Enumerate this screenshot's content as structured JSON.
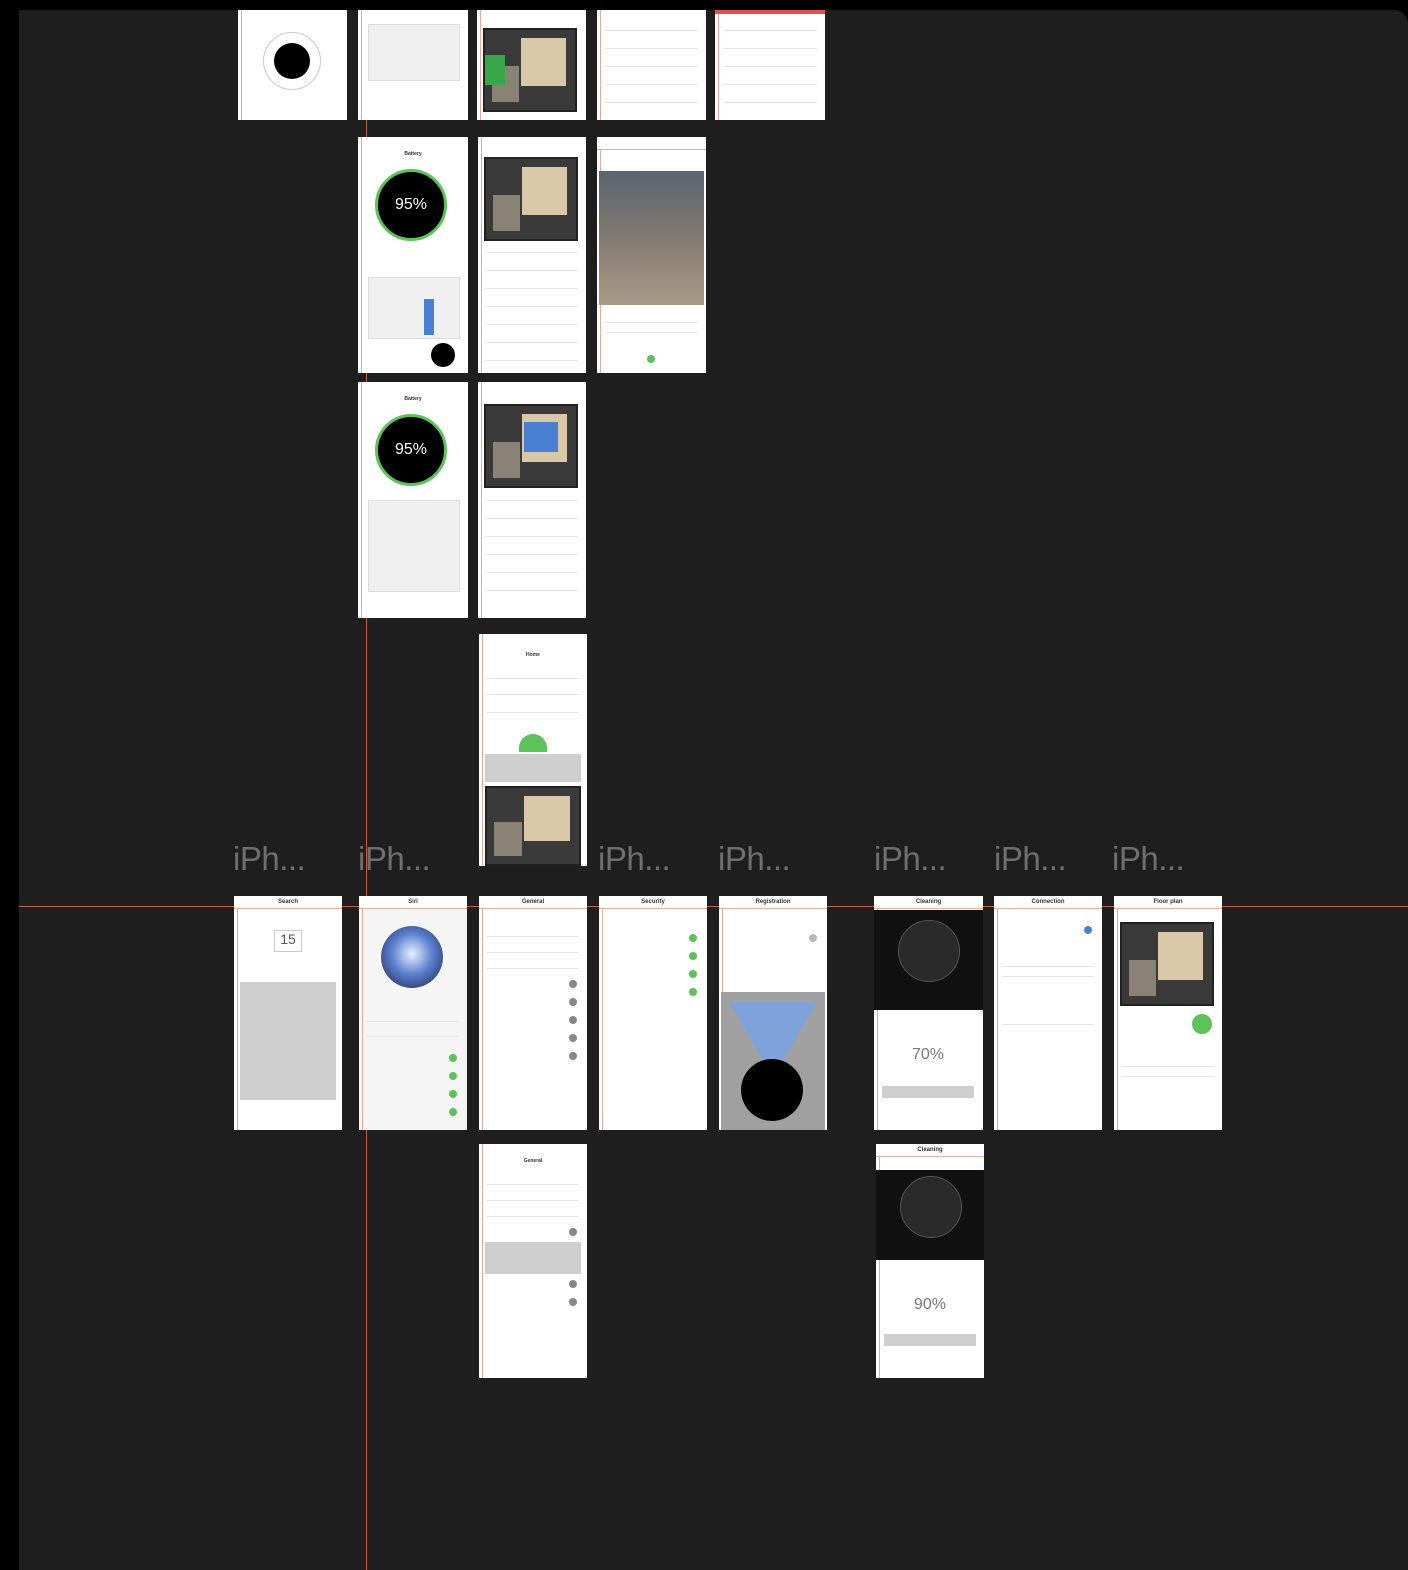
{
  "window": {
    "title": ""
  },
  "labels": [
    "iPh...",
    "iPh...",
    "iPh...",
    "iPh...",
    "iPh...",
    "iPh...",
    "iPh...",
    "iPh..."
  ],
  "frames": {
    "r1a": {
      "title": ""
    },
    "battery1": {
      "title": "Battery",
      "value": "95%"
    },
    "battery2": {
      "title": "Battery",
      "value": "95%"
    },
    "home": {
      "title": "Home"
    },
    "search": {
      "title": "Search",
      "value": "15"
    },
    "siri": {
      "title": "Siri"
    },
    "general": {
      "title": "General"
    },
    "security": {
      "title": "Security"
    },
    "registration": {
      "title": "Registration"
    },
    "cleaning1": {
      "title": "Cleaning",
      "value": "70%"
    },
    "connection": {
      "title": "Connection"
    },
    "floorplan": {
      "title": "Floor plan"
    },
    "general2": {
      "title": "General"
    },
    "cleaning2": {
      "title": "Cleaning",
      "value": "90%"
    }
  },
  "colors": {
    "accent": "#c2623f",
    "ok": "#5cc25a",
    "blue": "#4a7fd4"
  }
}
